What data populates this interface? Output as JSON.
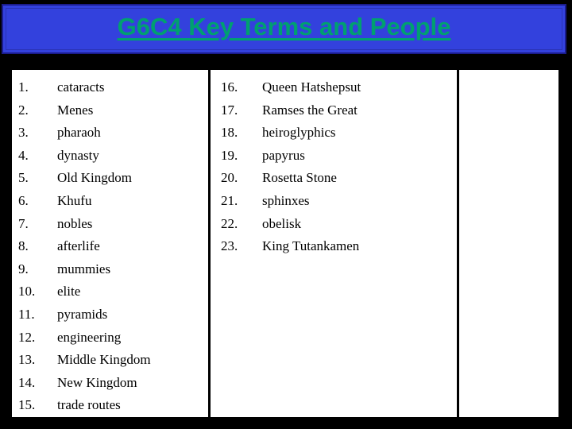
{
  "slide": {
    "title": "G6C4 Key Terms and People",
    "title_color": "#00A070",
    "banner_color": "#3341DD",
    "banner_border_color": "#1B1C8C",
    "background_color": "#000000",
    "table_background": "#FFFFFF"
  },
  "columns": [
    {
      "name": "left-column",
      "items": [
        {
          "number": "1.",
          "term": "cataracts"
        },
        {
          "number": "2.",
          "term": "Menes"
        },
        {
          "number": "3.",
          "term": "pharaoh"
        },
        {
          "number": "4.",
          "term": "dynasty"
        },
        {
          "number": "5.",
          "term": "Old Kingdom"
        },
        {
          "number": "6.",
          "term": "Khufu"
        },
        {
          "number": "7.",
          "term": "nobles"
        },
        {
          "number": "8.",
          "term": "afterlife"
        },
        {
          "number": "9.",
          "term": "mummies"
        },
        {
          "number": "10.",
          "term": "elite"
        },
        {
          "number": "11.",
          "term": "pyramids"
        },
        {
          "number": "12.",
          "term": "engineering"
        },
        {
          "number": "13.",
          "term": "Middle Kingdom"
        },
        {
          "number": "14.",
          "term": "New Kingdom"
        },
        {
          "number": "15.",
          "term": "trade routes"
        }
      ]
    },
    {
      "name": "middle-column",
      "items": [
        {
          "number": "16.",
          "term": "Queen Hatshepsut"
        },
        {
          "number": "17.",
          "term": "Ramses the Great"
        },
        {
          "number": "18.",
          "term": "heiroglyphics"
        },
        {
          "number": "19.",
          "term": "papyrus"
        },
        {
          "number": "20.",
          "term": "Rosetta Stone"
        },
        {
          "number": "21.",
          "term": "sphinxes"
        },
        {
          "number": "22.",
          "term": "obelisk"
        },
        {
          "number": "23.",
          "term": "King Tutankamen"
        }
      ]
    },
    {
      "name": "right-column",
      "items": []
    }
  ]
}
